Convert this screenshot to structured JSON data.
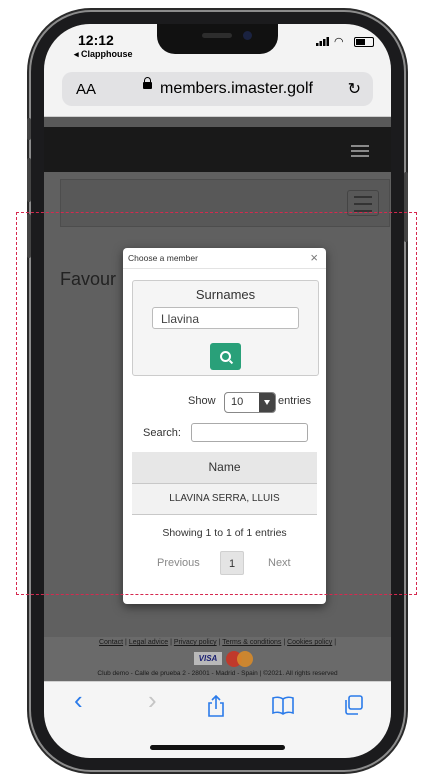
{
  "status": {
    "time": "12:12",
    "back_app": "◂ Clapphouse"
  },
  "browser": {
    "aa_label": "AA",
    "url": "members.imaster.golf",
    "reload_icon": "reload-icon"
  },
  "page": {
    "heading": "Favour"
  },
  "modal": {
    "title": "Choose a member",
    "close": "×",
    "search_panel": {
      "label": "Surnames",
      "input_value": "Llavina",
      "button_icon": "search-icon"
    },
    "length": {
      "prefix": "Show",
      "selected": "10",
      "suffix": "entries"
    },
    "filter": {
      "label": "Search:",
      "value": ""
    },
    "table": {
      "column": "Name",
      "rows": [
        "LLAVINA SERRA, LLUIS"
      ]
    },
    "info": "Showing 1 to 1 of 1 entries",
    "pagination": {
      "previous": "Previous",
      "page": "1",
      "next": "Next"
    }
  },
  "footer": {
    "links": [
      "Contact",
      "Legal advice",
      "Privacy policy",
      "Terms & conditions",
      "Cookies policy"
    ],
    "sep": " | ",
    "card_visa": "VISA",
    "copyright": "Club demo - Calle de prueba 2 - 28001 - Madrid - Spain | ©2021. All rights reserved"
  },
  "toolbar": {
    "back": "‹",
    "forward": "›",
    "icons": [
      "back-icon",
      "forward-icon",
      "share-icon",
      "bookmarks-icon",
      "tabs-icon"
    ]
  },
  "colors": {
    "accent": "#29a079",
    "annotation_border": "#d6284f",
    "safari_blue": "#2b7bea"
  }
}
